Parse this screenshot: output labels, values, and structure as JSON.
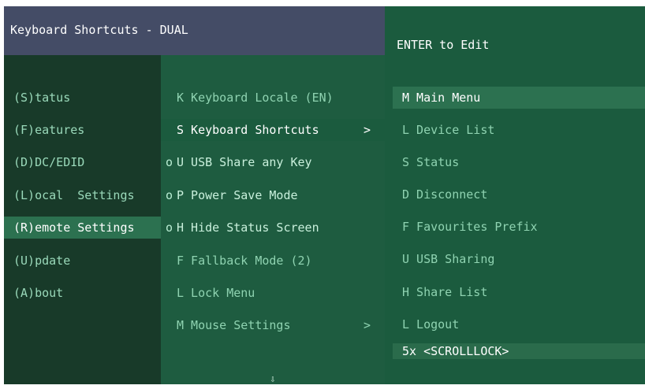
{
  "title": "Keyboard Shortcuts - DUAL",
  "hint": "ENTER to Edit",
  "main_menu": [
    {
      "label": "(S)tatus",
      "selected": false
    },
    {
      "label": "(F)eatures",
      "selected": false
    },
    {
      "label": "(D)DC/EDID",
      "selected": false
    },
    {
      "label": "(L)ocal  Settings",
      "selected": false
    },
    {
      "label": "(R)emote Settings",
      "selected": true
    },
    {
      "label": "(U)pdate",
      "selected": false
    },
    {
      "label": "(A)bout",
      "selected": false
    }
  ],
  "submenu": [
    {
      "bullet": "",
      "label": "K Keyboard Locale (EN)",
      "arrow": "",
      "selected": false
    },
    {
      "bullet": "",
      "label": "S Keyboard Shortcuts",
      "arrow": ">",
      "selected": true
    },
    {
      "bullet": "o",
      "label": "U USB Share any Key",
      "arrow": "",
      "selected": false
    },
    {
      "bullet": "o",
      "label": "P Power Save Mode",
      "arrow": "",
      "selected": false
    },
    {
      "bullet": "o",
      "label": "H Hide Status Screen",
      "arrow": "",
      "selected": false
    },
    {
      "bullet": "",
      "label": "F Fallback Mode (2)",
      "arrow": "",
      "selected": false
    },
    {
      "bullet": "",
      "label": "L Lock Menu",
      "arrow": "",
      "selected": false
    },
    {
      "bullet": "",
      "label": "M Mouse Settings",
      "arrow": ">",
      "selected": false
    }
  ],
  "shortcuts": [
    {
      "label": "M Main Menu",
      "selected": true
    },
    {
      "label": "L Device List",
      "selected": false
    },
    {
      "label": "S Status",
      "selected": false
    },
    {
      "label": "D Disconnect",
      "selected": false
    },
    {
      "label": "F Favourites Prefix",
      "selected": false
    },
    {
      "label": "U USB Sharing",
      "selected": false
    },
    {
      "label": "H Share List",
      "selected": false
    },
    {
      "label": "L Logout",
      "selected": false
    }
  ],
  "hotkey": "5x <SCROLLLOCK>",
  "scroll_indicator": "⇩",
  "colors": {
    "title_bg": "#444c66",
    "left_panel": "#183a29",
    "mid_panel": "#1e5c40",
    "right_panel": "#1b5b3e",
    "highlight": "#2c7150",
    "text_dim": "#8fd3b1",
    "text_bright": "#ffffff"
  }
}
